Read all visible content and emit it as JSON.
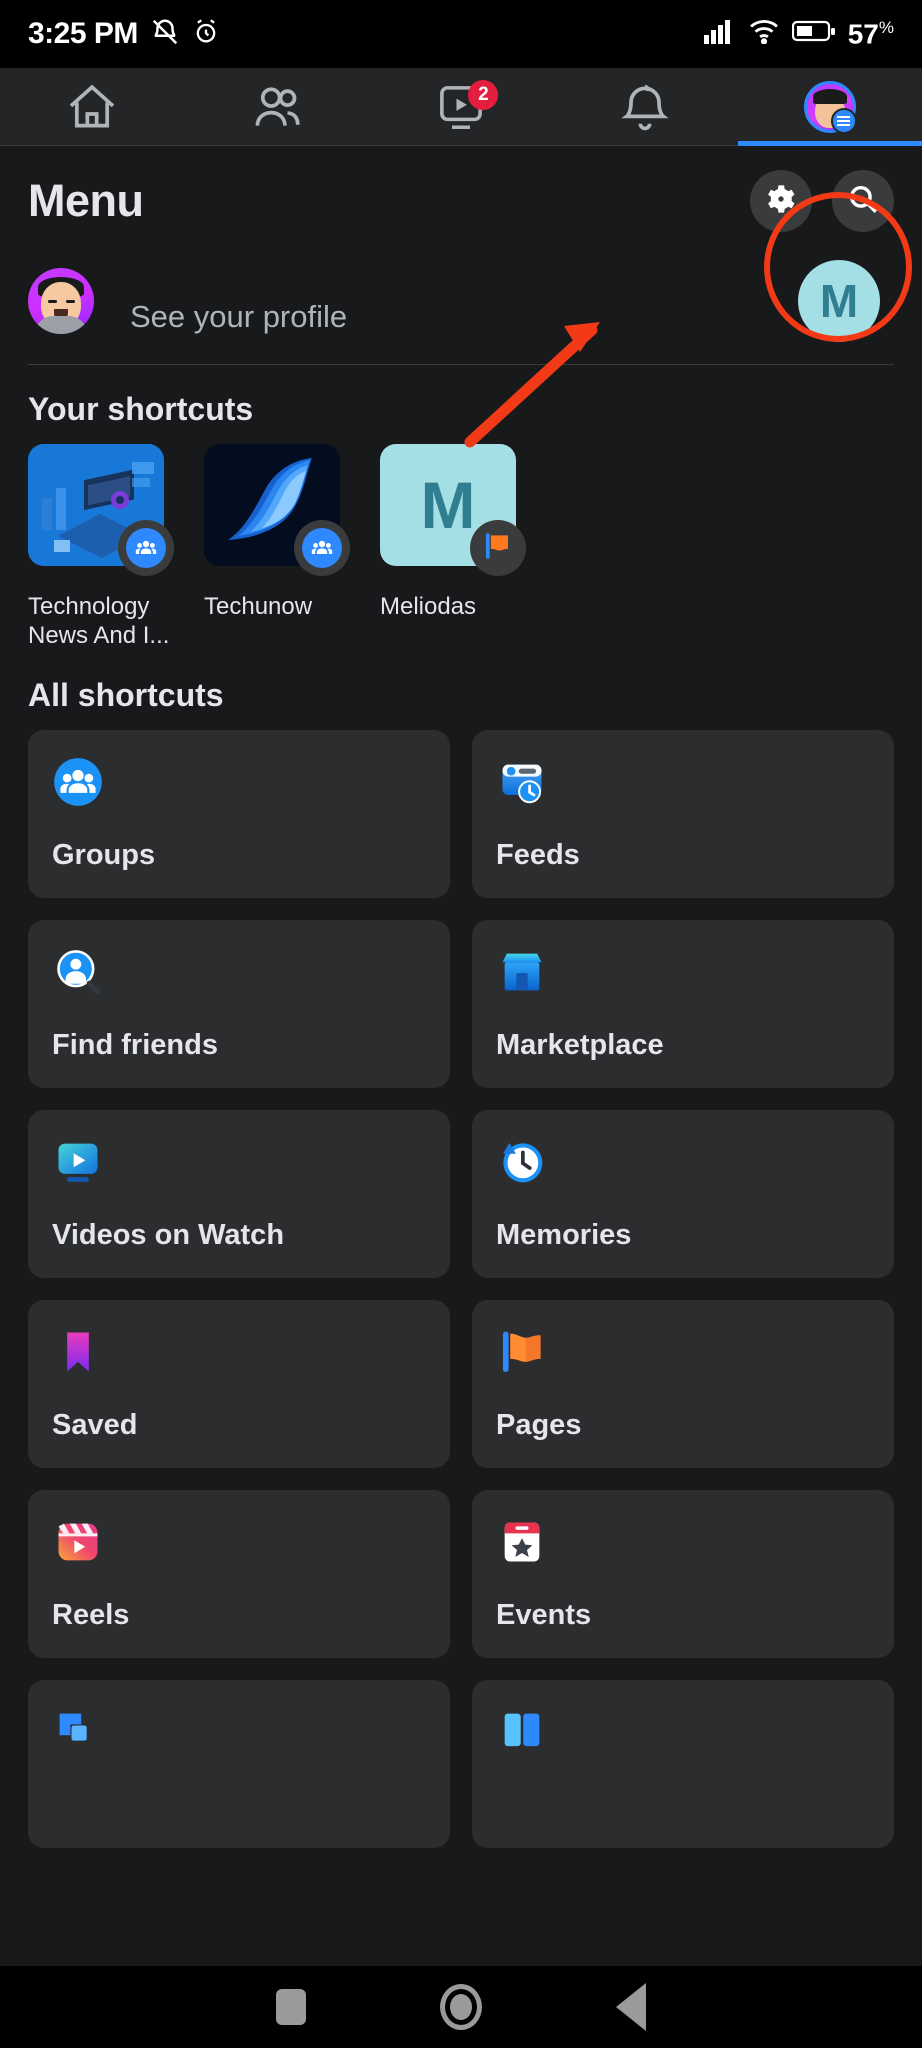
{
  "statusbar": {
    "time": "3:25 PM",
    "battery_percent": "57",
    "percent_symbol": "%",
    "icons": [
      "mute-icon",
      "alarm-icon",
      "cellular-signal-icon",
      "wifi-icon",
      "battery-icon"
    ]
  },
  "topnav": {
    "items": [
      {
        "name": "home-tab",
        "icon": "home-icon",
        "badge": ""
      },
      {
        "name": "friends-tab",
        "icon": "friends-icon",
        "badge": ""
      },
      {
        "name": "video-tab",
        "icon": "video-icon",
        "badge": "2"
      },
      {
        "name": "notifications-tab",
        "icon": "bell-icon",
        "badge": ""
      },
      {
        "name": "menu-tab",
        "icon": "profile-avatar-icon",
        "badge": ""
      }
    ],
    "active_index": 4
  },
  "header": {
    "title": "Menu",
    "settings_icon": "gear-icon",
    "search_icon": "search-icon"
  },
  "profile": {
    "name_redacted": "",
    "see_profile": "See your profile",
    "account_switch_initial": "M",
    "account_switch_color": "#a5dfe6",
    "highlight_color": "#f23a16"
  },
  "your_shortcuts": {
    "heading": "Your shortcuts",
    "items": [
      {
        "label": "Technology News And I...",
        "badge": "group-icon",
        "thumb": "tech-illustration"
      },
      {
        "label": "Techunow",
        "badge": "group-icon",
        "thumb": "windows-wallpaper"
      },
      {
        "label": "Meliodas",
        "badge": "page-flag-icon",
        "thumb": "letter-m",
        "initial": "M"
      }
    ]
  },
  "all_shortcuts": {
    "heading": "All shortcuts",
    "items": [
      {
        "label": "Groups",
        "icon": "groups-icon"
      },
      {
        "label": "Feeds",
        "icon": "feeds-icon"
      },
      {
        "label": "Find friends",
        "icon": "find-friends-icon"
      },
      {
        "label": "Marketplace",
        "icon": "marketplace-icon"
      },
      {
        "label": "Videos on Watch",
        "icon": "watch-video-icon"
      },
      {
        "label": "Memories",
        "icon": "memories-clock-icon"
      },
      {
        "label": "Saved",
        "icon": "saved-bookmark-icon"
      },
      {
        "label": "Pages",
        "icon": "pages-flag-icon"
      },
      {
        "label": "Reels",
        "icon": "reels-icon"
      },
      {
        "label": "Events",
        "icon": "events-calendar-icon"
      },
      {
        "label": "",
        "icon": "messenger-blue-icon"
      },
      {
        "label": "",
        "icon": "blue-book-icon"
      }
    ]
  },
  "android_nav": {
    "recents": "recents-button",
    "home": "home-button",
    "back": "back-button"
  }
}
